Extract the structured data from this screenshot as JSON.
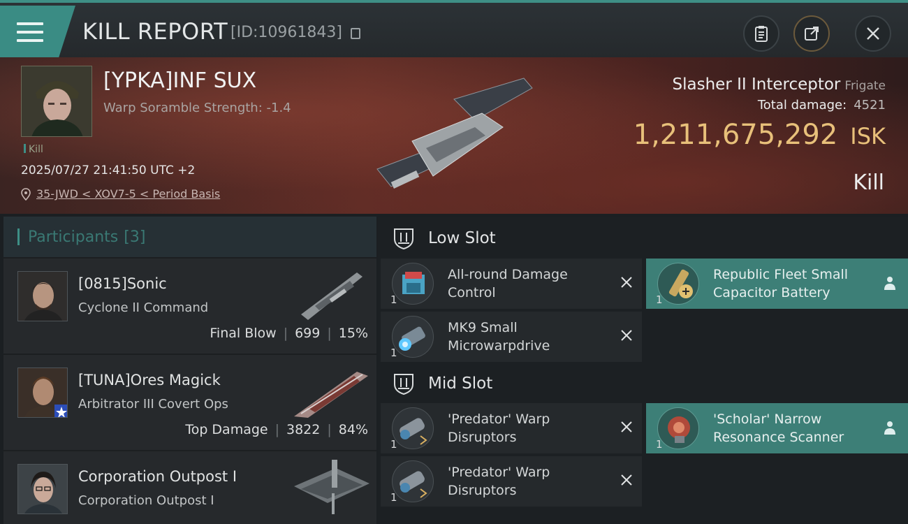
{
  "header": {
    "title": "KILL REPORT",
    "report_id": "[ID:10961843]"
  },
  "victim": {
    "name": "[YPKA]INF SUX",
    "scramble": "Warp Soramble Strength: -1.4",
    "tag": "Kill",
    "datetime": "2025/07/27 21:41:50 UTC +2",
    "location": "35-JWD < XOV7-5 < Period Basis",
    "ship_name": "Slasher II Interceptor",
    "ship_class": "Frigate",
    "damage_label": "Total damage:",
    "damage_value": "4521",
    "isk_value": "1,211,675,292",
    "isk_unit": "ISK",
    "result": "Kill"
  },
  "participants": {
    "title": "Participants",
    "count": "[3]",
    "items": [
      {
        "name": "[0815]Sonic",
        "ship": "Cyclone II Command",
        "stat_label": "Final Blow",
        "damage": "699",
        "percent": "15%"
      },
      {
        "name": "[TUNA]Ores Magick",
        "ship": "Arbitrator III Covert Ops",
        "stat_label": "Top Damage",
        "damage": "3822",
        "percent": "84%"
      },
      {
        "name": "Corporation Outpost I",
        "ship": "Corporation Outpost I"
      }
    ]
  },
  "slots": {
    "low": {
      "title": "Low Slot",
      "modules": [
        {
          "name": "All-round Damage Control",
          "qty": "1"
        },
        {
          "name": "Republic Fleet Small Capacitor Battery",
          "qty": "1"
        },
        {
          "name": "MK9 Small Microwarpdrive",
          "qty": "1"
        }
      ]
    },
    "mid": {
      "title": "Mid Slot",
      "modules": [
        {
          "name": "'Predator' Warp Disruptors",
          "qty": "1"
        },
        {
          "name": "'Scholar' Narrow Resonance Scanner",
          "qty": "1"
        },
        {
          "name": "'Predator' Warp Disruptors",
          "qty": "1"
        }
      ]
    }
  }
}
